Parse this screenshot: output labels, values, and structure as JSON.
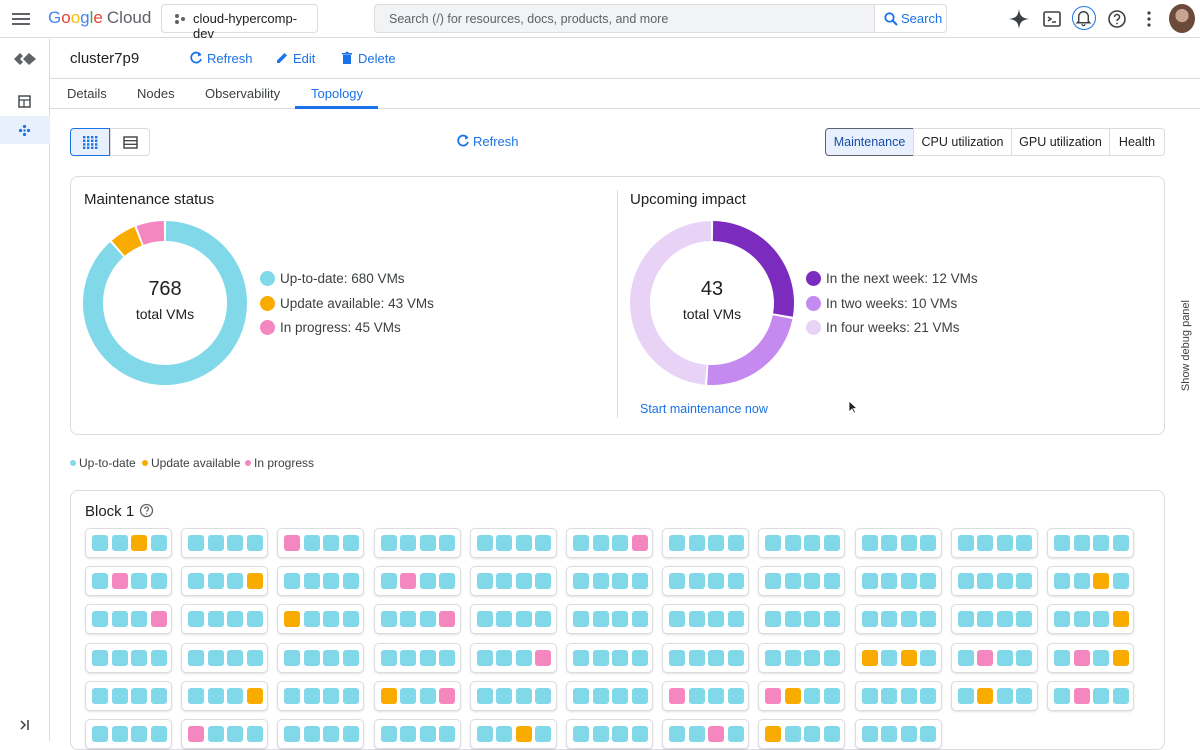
{
  "header": {
    "logo_google": [
      "G",
      "o",
      "o",
      "g",
      "l",
      "e"
    ],
    "logo_cloud": "Cloud",
    "project": "cloud-hypercomp-dev",
    "search_placeholder": "Search (/) for resources, docs, products, and more",
    "search_button": "Search"
  },
  "page": {
    "cluster_name": "cluster7p9",
    "refresh": "Refresh",
    "edit": "Edit",
    "delete": "Delete"
  },
  "tabs": [
    "Details",
    "Nodes",
    "Observability",
    "Topology"
  ],
  "active_tab": "Topology",
  "toolbar": {
    "refresh": "Refresh",
    "segments": [
      "Maintenance",
      "CPU utilization",
      "GPU utilization",
      "Health"
    ],
    "active_segment": "Maintenance"
  },
  "colors": {
    "up_to_date": "#80d8e8",
    "update_available": "#f9ab00",
    "in_progress": "#f587c0",
    "next_week": "#7b2cbf",
    "two_weeks": "#c58af0",
    "four_weeks": "#e8d3f7",
    "accent": "#1a73e8"
  },
  "maintenance": {
    "title": "Maintenance status",
    "total": "768",
    "total_label": "total VMs",
    "legend": [
      "Up-to-date: 680 VMs",
      "Update available: 43 VMs",
      "In progress: 45 VMs"
    ],
    "values": [
      680,
      43,
      45
    ]
  },
  "impact": {
    "title": "Upcoming impact",
    "total": "43",
    "total_label": "total VMs",
    "legend": [
      "In the next week: 12 VMs",
      "In two weeks: 10 VMs",
      "In four weeks: 21 VMs"
    ],
    "values": [
      12,
      10,
      21
    ],
    "link": "Start maintenance now"
  },
  "status_legend": [
    "Up-to-date",
    "Update available",
    "In progress"
  ],
  "block": {
    "title": "Block 1",
    "rows": [
      [
        "uuau",
        "uuuu",
        "puuu",
        "uuuu",
        "uuuu",
        "uuup",
        "uuuu",
        "uuuu",
        "uuuu",
        "uuuu",
        "uuuu"
      ],
      [
        "upuu",
        "uuua",
        "uuuu",
        "upuu",
        "uuuu",
        "uuuu",
        "uuuu",
        "uuuu",
        "uuuu",
        "uuuu",
        "uuau"
      ],
      [
        "uuup",
        "uuuu",
        "auuu",
        "uuup",
        "uuuu",
        "uuuu",
        "uuuu",
        "uuuu",
        "uuuu",
        "uuuu",
        "uuua"
      ],
      [
        "uuuu",
        "uuuu",
        "uuuu",
        "uuuu",
        "uuup",
        "uuuu",
        "uuuu",
        "uuuu",
        "auau",
        "upuu",
        "upua"
      ],
      [
        "uuuu",
        "uuua",
        "uuuu",
        "auup",
        "uuuu",
        "uuuu",
        "puuu",
        "pauu",
        "uuuu",
        "uauu",
        "upuu"
      ],
      [
        "uuuu",
        "puuu",
        "uuuu",
        "uuuu",
        "uuau",
        "uuuu",
        "uupu",
        "auuu",
        "uuuu"
      ]
    ]
  },
  "debug_panel": "Show debug panel"
}
